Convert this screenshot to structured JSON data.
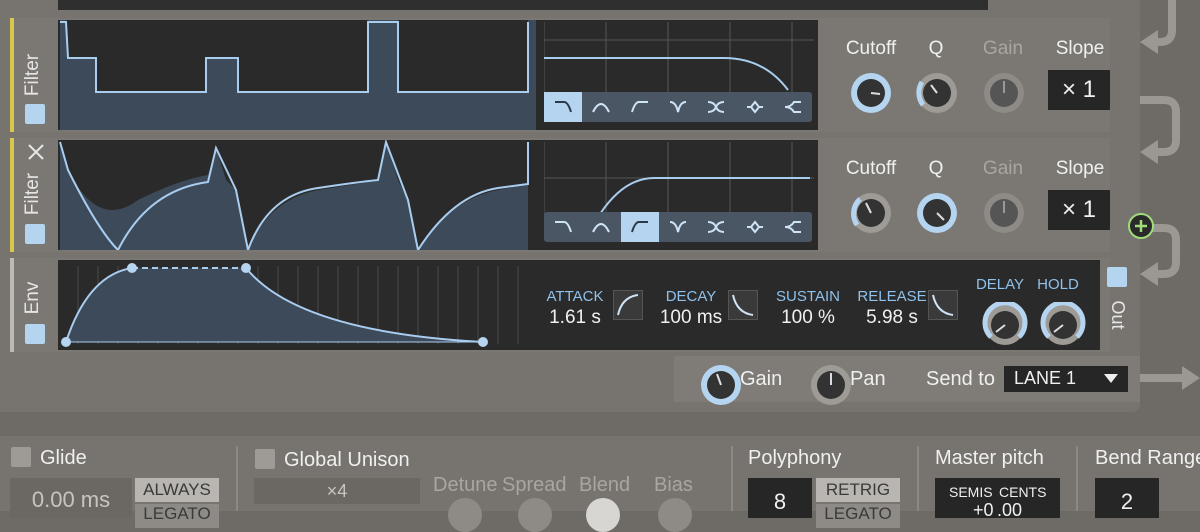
{
  "filter1": {
    "label": "Filter",
    "params": {
      "cutoff": "Cutoff",
      "q": "Q",
      "gain": "Gain",
      "slope": "Slope"
    },
    "slope_value": "× 1",
    "selected_type": 0
  },
  "filter2": {
    "label": "Filter",
    "params": {
      "cutoff": "Cutoff",
      "q": "Q",
      "gain": "Gain",
      "slope": "Slope"
    },
    "slope_value": "× 1",
    "selected_type": 2
  },
  "filter_types": [
    "lowpass-icon",
    "bandpass-icon",
    "highpass-icon",
    "notch-icon",
    "peak-icon",
    "bell-icon",
    "shelf-icon"
  ],
  "env": {
    "label": "Env",
    "attack": {
      "name": "ATTACK",
      "value": "1.61 s"
    },
    "decay": {
      "name": "DECAY",
      "value": "100 ms"
    },
    "sustain": {
      "name": "SUSTAIN",
      "value": "100 %"
    },
    "release": {
      "name": "RELEASE",
      "value": "5.98 s"
    },
    "delay": "DELAY",
    "hold": "HOLD",
    "out": "Out"
  },
  "output": {
    "gain": "Gain",
    "pan": "Pan",
    "send_to": "Send to",
    "lane": "LANE 1"
  },
  "bottom": {
    "glide": "Glide",
    "glide_value": "0.00 ms",
    "always": "ALWAYS",
    "legato": "LEGATO",
    "global_unison": "Global Unison",
    "unison_value": "×4",
    "detune": "Detune",
    "spread": "Spread",
    "blend": "Blend",
    "bias": "Bias",
    "polyphony": "Polyphony",
    "polyphony_value": "8",
    "retrig": "RETRIG",
    "legato2": "LEGATO",
    "master_pitch": "Master pitch",
    "semis": "SEMIS",
    "cents": "CENTS",
    "semis_value": "+0",
    "cents_value": ".00",
    "bend_range": "Bend Range",
    "bend_value": "2"
  },
  "colors": {
    "accent": "#b4d4f0",
    "filter_bar": "#d8c84a",
    "env_bar": "#bdbab5",
    "add_button": "#9fdc7a"
  }
}
